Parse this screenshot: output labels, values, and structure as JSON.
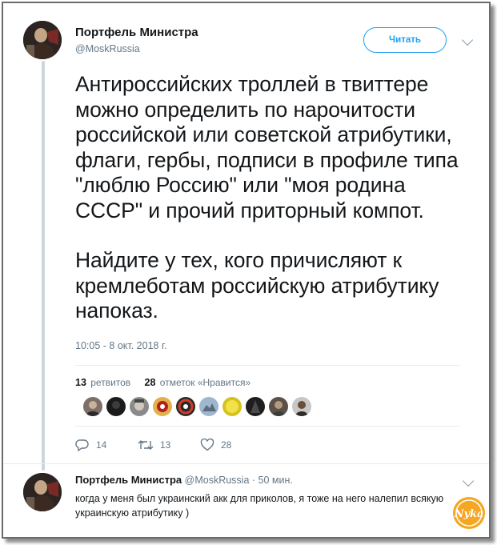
{
  "tweet": {
    "author_name": "Портфель Министра",
    "author_handle": "@MoskRussia",
    "follow_label": "Читать",
    "paragraphs": [
      "Антироссийских троллей в твиттере можно определить по нарочитости российской или советской атрибутики, флаги, гербы, подписи в профиле типа \"люблю Россию\" или \"моя родина СССР\" и прочий приторный компот.",
      "Найдите у тех, кого причисляют к кремлеботам российскую атрибутику напоказ."
    ],
    "timestamp": "10:05 - 8 окт. 2018 г.",
    "retweets_count": "13",
    "retweets_label": "ретвитов",
    "likes_count": "28",
    "likes_label": "отметок «Нравится»",
    "actions": {
      "replies": "14",
      "retweets": "13",
      "likes": "28"
    }
  },
  "reply": {
    "author_name": "Портфель Министра",
    "author_handle": "@MoskRussia",
    "time": "50 мин.",
    "text": "когда у меня был украинский акк для приколов, я тоже на него налепил всякую украинскую атрибутику )"
  },
  "watermark": {
    "text": "Nyka"
  },
  "colors": {
    "accent": "#1da1f2",
    "secondary_text": "#657786",
    "thread_line": "#ccd6dd"
  },
  "icons": [
    "chevron-down-icon",
    "reply-icon",
    "retweet-icon",
    "heart-icon"
  ]
}
